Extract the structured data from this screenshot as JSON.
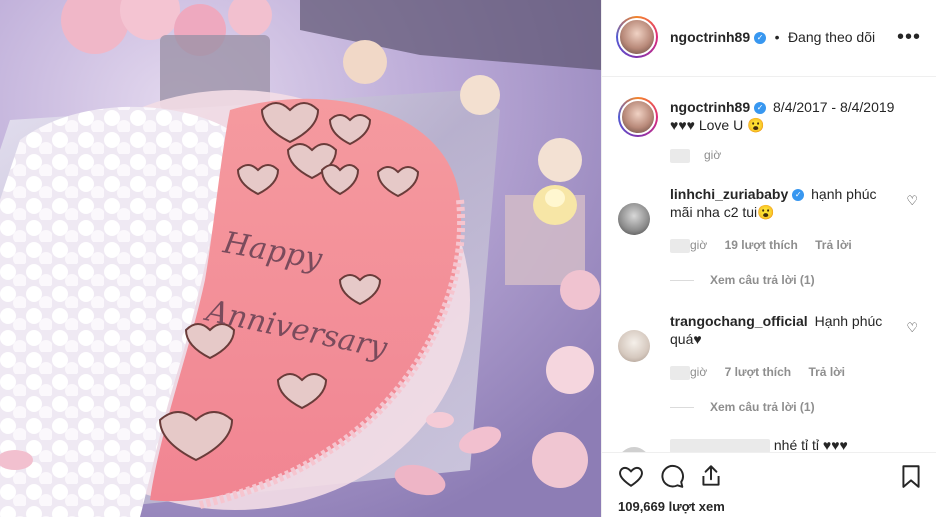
{
  "post": {
    "username": "ngoctrinh89",
    "follow_status": "Đang theo dõi",
    "more_label": "•••",
    "caption_username": "ngoctrinh89",
    "caption_text": "8/4/2017 - 8/4/2019",
    "caption_line2": "♥♥♥ Love U 😮",
    "caption_time": "giờ",
    "views": "109,669 lượt xem"
  },
  "comments": [
    {
      "username": "linhchi_zuriababy",
      "text": "hạnh phúc mãi nha c2 tui😮",
      "time": "giờ",
      "likes": "19 lượt thích",
      "reply": "Trả lời",
      "view_replies": "Xem câu trả lời (1)"
    },
    {
      "username": "trangochang_official",
      "text": "Hạnh phúc quá♥",
      "time": "giờ",
      "likes": "7 lượt thích",
      "reply": "Trả lời",
      "view_replies": "Xem câu trả lời (1)"
    },
    {
      "partial_text": "nhé tỉ tỉ ♥♥♥"
    }
  ],
  "image": {
    "cake_text_1": "Happy",
    "cake_text_2": "Anniversary"
  },
  "icons": [
    "heart-icon",
    "comment-icon",
    "share-icon",
    "bookmark-icon",
    "verified-badge-icon",
    "more-options-icon"
  ]
}
